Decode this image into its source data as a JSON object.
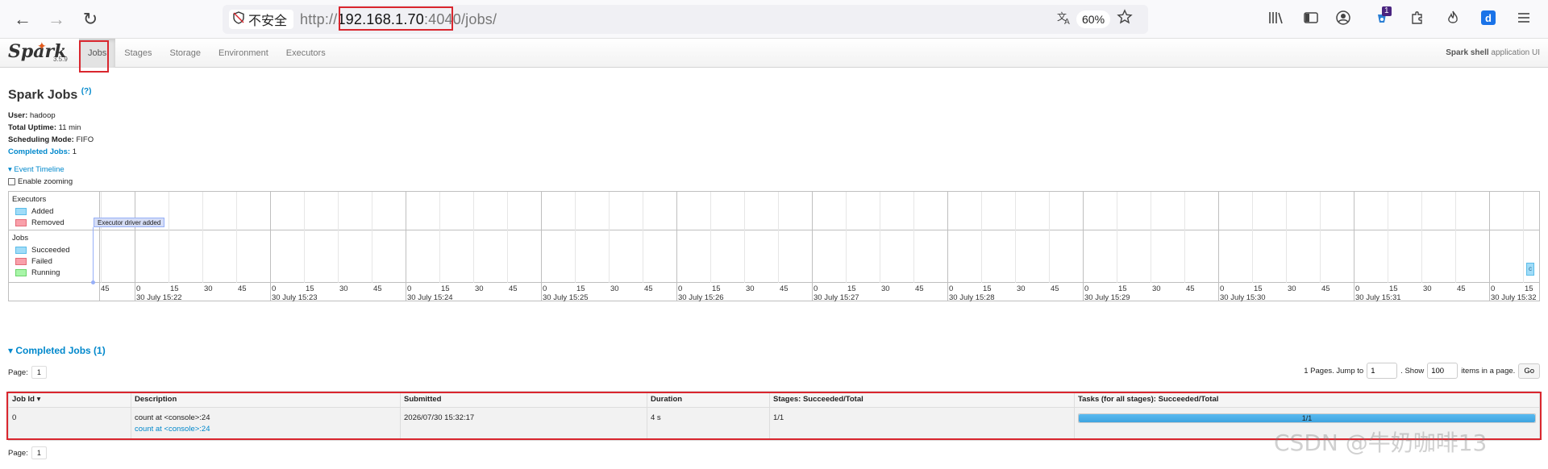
{
  "browser": {
    "back_icon": "←",
    "forward_icon": "→",
    "reload_icon": "↻",
    "security_label": "不安全",
    "url_scheme": "http://",
    "url_host": "192.168.1.70",
    "url_port": ":4040",
    "url_path": "/jobs/",
    "zoom": "60%",
    "extension_badge": "1"
  },
  "spark": {
    "logo_text": "Spark",
    "version": "3.5.9",
    "tabs": [
      "Jobs",
      "Stages",
      "Storage",
      "Environment",
      "Executors"
    ],
    "app_name_bold": "Spark shell",
    "app_name_suffix": "application UI"
  },
  "page": {
    "title": "Spark Jobs",
    "help": "(?)",
    "user_key": "User:",
    "user": "hadoop",
    "uptime_key": "Total Uptime:",
    "uptime": "11 min",
    "mode_key": "Scheduling Mode:",
    "mode": "FIFO",
    "completed_key": "Completed Jobs:",
    "completed": "1"
  },
  "timeline": {
    "toggle": "▾ Event Timeline",
    "enable_zooming": "Enable zooming",
    "executors_label": "Executors",
    "executors_legend": [
      "Added",
      "Removed"
    ],
    "jobs_label": "Jobs",
    "jobs_legend": [
      "Succeeded",
      "Failed",
      "Running"
    ],
    "event": "Executor driver added",
    "job_marker": "c",
    "minute_labels": [
      "30 July 15:22",
      "30 July 15:23",
      "30 July 15:24",
      "30 July 15:25",
      "30 July 15:26",
      "30 July 15:27",
      "30 July 15:28",
      "30 July 15:29",
      "30 July 15:30",
      "30 July 15:31",
      "30 July 15:32"
    ],
    "second_labels": [
      "0",
      "15",
      "30",
      "45"
    ],
    "first_label": "45"
  },
  "completed_jobs": {
    "heading": "▾ Completed Jobs (1)",
    "page_label": "Page:",
    "page_num": "1",
    "pages_text": "1 Pages. Jump to",
    "jump_value": "1",
    "show_text": ". Show",
    "show_value": "100",
    "items_text": "items in a page.",
    "go": "Go",
    "headers": [
      "Job Id ▾",
      "Description",
      "Submitted",
      "Duration",
      "Stages: Succeeded/Total",
      "Tasks (for all stages): Succeeded/Total"
    ],
    "rows": [
      {
        "job_id": "0",
        "description": "count at <console>:24",
        "description_link": "count at <console>:24",
        "submitted": "2026/07/30 15:32:17",
        "duration": "4 s",
        "stages": "1/1",
        "tasks": "1/1",
        "tasks_fraction": 1.0
      }
    ]
  },
  "colors": {
    "added": "#a0dcf8",
    "removed": "#f9a0aa",
    "succeeded": "#a0dcf8",
    "failed": "#f9a0aa",
    "running": "#a8f5a8",
    "link": "#0088cc",
    "highlight": "#d9262e"
  },
  "watermark": "CSDN @牛奶咖啡13"
}
